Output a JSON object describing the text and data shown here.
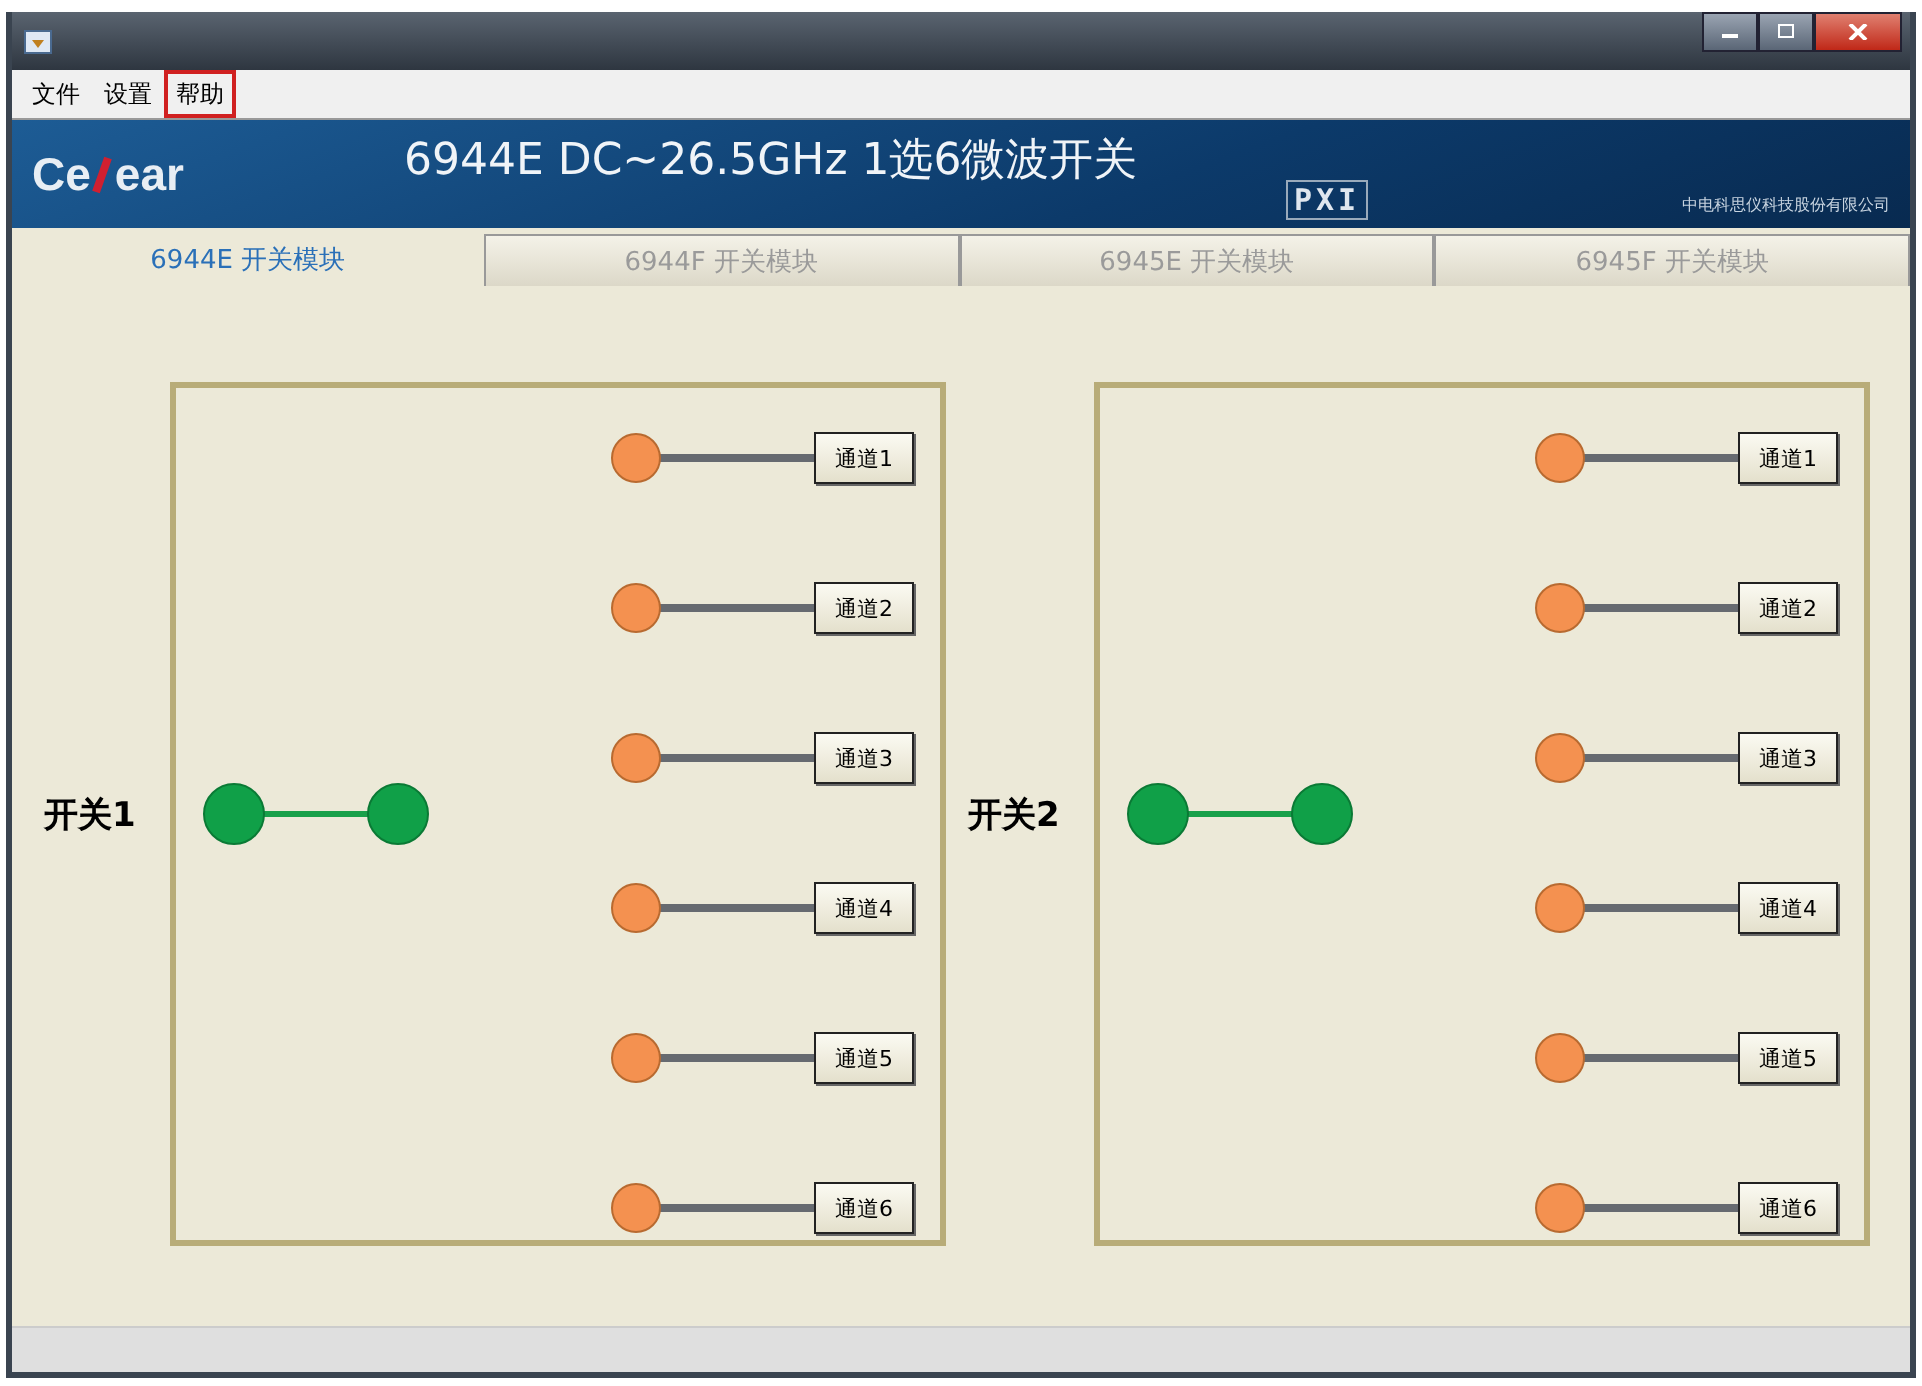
{
  "menu": [
    {
      "label": "文件",
      "selected": false
    },
    {
      "label": "设置",
      "selected": false
    },
    {
      "label": "帮助",
      "selected": true
    }
  ],
  "banner": {
    "logo_left": "Ce",
    "logo_right": "ear",
    "title": "6944E DC~26.5GHz 1选6微波开关",
    "badge": "PXI",
    "company": "中电科思仪科技股份有限公司"
  },
  "tabs": [
    {
      "label": "6944E 开关模块",
      "selected": true
    },
    {
      "label": "6944F 开关模块",
      "selected": false
    },
    {
      "label": "6945E 开关模块",
      "selected": false
    },
    {
      "label": "6945F 开关模块",
      "selected": false
    }
  ],
  "switches": [
    {
      "label": "开关1",
      "channels": [
        "通道1",
        "通道2",
        "通道3",
        "通道4",
        "通道5",
        "通道6"
      ]
    },
    {
      "label": "开关2",
      "channels": [
        "通道1",
        "通道2",
        "通道3",
        "通道4",
        "通道5",
        "通道6"
      ]
    }
  ]
}
